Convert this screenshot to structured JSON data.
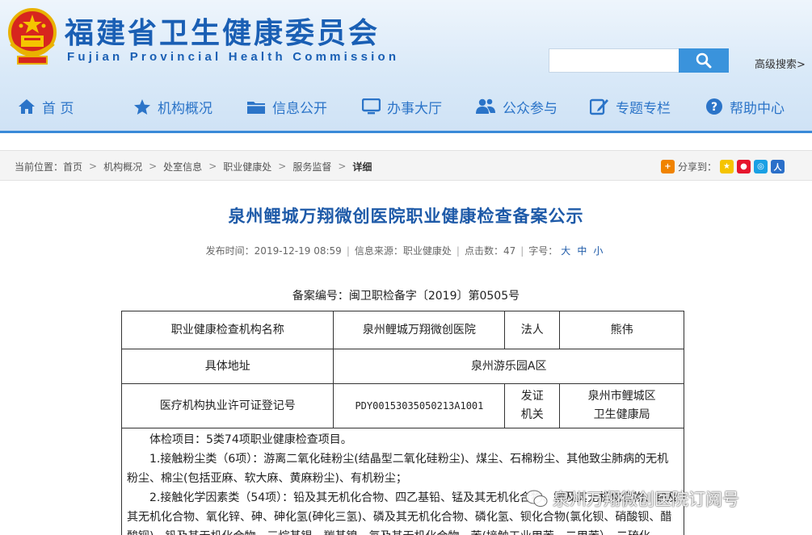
{
  "header": {
    "site_title": "福建省卫生健康委员会",
    "site_subtitle": "Fujian Provincial Health Commission",
    "search_placeholder": "",
    "advanced_search": "高级搜索>"
  },
  "nav": [
    {
      "label": "首 页",
      "icon": "home-icon"
    },
    {
      "label": "机构概况",
      "icon": "star-icon"
    },
    {
      "label": "信息公开",
      "icon": "folder-icon"
    },
    {
      "label": "办事大厅",
      "icon": "monitor-icon"
    },
    {
      "label": "公众参与",
      "icon": "users-icon"
    },
    {
      "label": "专题专栏",
      "icon": "edit-icon"
    },
    {
      "label": "帮助中心",
      "icon": "help-icon"
    }
  ],
  "breadcrumb": {
    "prefix": "当前位置：",
    "items": [
      "首页",
      "机构概况",
      "处室信息",
      "职业健康处",
      "服务监督",
      "详细"
    ],
    "separator": ">"
  },
  "share": {
    "label": "分享到："
  },
  "article": {
    "title": "泉州鲤城万翔微创医院职业健康检查备案公示",
    "meta": {
      "time_label": "发布时间：",
      "time": "2019-12-19 08:59",
      "source_label": "信息来源：",
      "source": "职业健康处",
      "clicks_label": "点击数：",
      "clicks": "47",
      "font_label": "字号：",
      "font_large": "大",
      "font_medium": "中",
      "font_small": "小"
    },
    "record_no": "备案编号：闽卫职检备字〔2019〕第0505号",
    "table": {
      "r1": {
        "label": "职业健康检查机构名称",
        "value": "泉州鲤城万翔微创医院",
        "label2": "法人",
        "value2": "熊伟"
      },
      "r2": {
        "label": "具体地址",
        "value": "泉州游乐园A区"
      },
      "r3": {
        "label": "医疗机构执业许可证登记号",
        "value": "PDY00153035050213A1001",
        "label2a": "发证",
        "label2b": "机关",
        "value2a": "泉州市鲤城区",
        "value2b": "卫生健康局"
      },
      "content": [
        "体检项目：5类74项职业健康检查项目。",
        "1.接触粉尘类（6项）：游离二氧化硅粉尘(结晶型二氧化硅粉尘)、煤尘、石棉粉尘、其他致尘肺病的无机粉尘、棉尘(包括亚麻、软大麻、黄麻粉尘)、有机粉尘；",
        "2.接触化学因素类（54项）：铅及其无机化合物、四乙基铅、锰及其无机化合物、铍及其无机化合物、镉及其无机化合物、氧化锌、砷、砷化氢(砷化三氢)、磷及其无机化合物、磷化氢、钡化合物(氯化钡、硝酸钡、醋酸钡)、钒及其无机化合物、三烷基锡、羰基镍、氟及其无机化合物、苯(接触工业甲苯、二甲苯）、二硫化"
      ]
    }
  },
  "watermark": "泉州万翔微创医院订阅号",
  "colors": {
    "brand": "#1a5fb4",
    "accent": "#3a93dc",
    "title": "#1e5aa8"
  }
}
